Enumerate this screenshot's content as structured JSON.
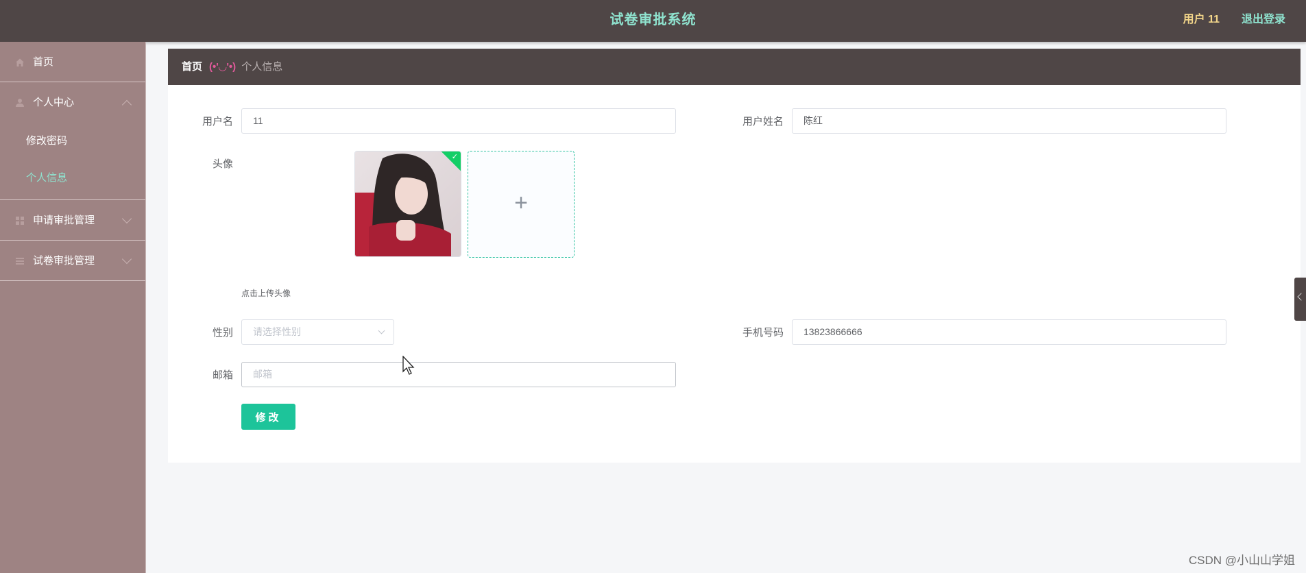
{
  "header": {
    "title": "试卷审批系统",
    "user": "用户 11",
    "logout": "退出登录"
  },
  "sidebar": {
    "items": [
      {
        "label": "首页",
        "icon": "home-icon"
      },
      {
        "label": "个人中心",
        "icon": "user-icon",
        "sub": [
          {
            "label": "修改密码"
          },
          {
            "label": "个人信息",
            "active": true
          }
        ]
      },
      {
        "label": "申请审批管理",
        "icon": "grid-icon"
      },
      {
        "label": "试卷审批管理",
        "icon": "list-icon"
      }
    ]
  },
  "breadcrumb": {
    "home": "首页",
    "separator": "(•'◡'•)",
    "current": "个人信息"
  },
  "form": {
    "username_label": "用户名",
    "username_value": "11",
    "realname_label": "用户姓名",
    "realname_value": "陈红",
    "avatar_label": "头像",
    "avatar_hint": "点击上传头像",
    "gender_label": "性别",
    "gender_placeholder": "请选择性别",
    "phone_label": "手机号码",
    "phone_value": "13823866666",
    "email_label": "邮箱",
    "email_placeholder": "邮箱",
    "submit_label": "修改"
  },
  "watermark": "CSDN @小山山学姐",
  "colors": {
    "header_bg": "#4f4646",
    "sidebar_bg": "#9e8383",
    "accent": "#8fe3cf",
    "button": "#1dc49a"
  }
}
